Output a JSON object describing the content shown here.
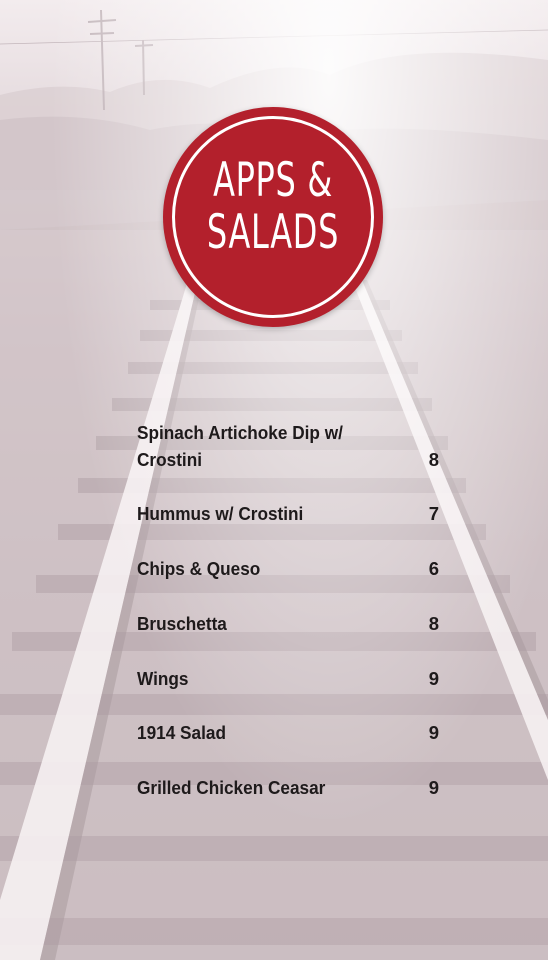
{
  "badge": {
    "line1": "APPS &",
    "line2": "SALADS"
  },
  "menu": [
    {
      "name": "Spinach Artichoke Dip w/ Crostini",
      "price": "8"
    },
    {
      "name": "Hummus w/ Crostini",
      "price": "7"
    },
    {
      "name": "Chips & Queso",
      "price": "6"
    },
    {
      "name": "Bruschetta",
      "price": "8"
    },
    {
      "name": "Wings",
      "price": "9"
    },
    {
      "name": "1914 Salad",
      "price": "9"
    },
    {
      "name": "Grilled Chicken Ceasar",
      "price": "9"
    }
  ],
  "colors": {
    "badge": "#b3202c",
    "text": "#1e1a1b"
  }
}
